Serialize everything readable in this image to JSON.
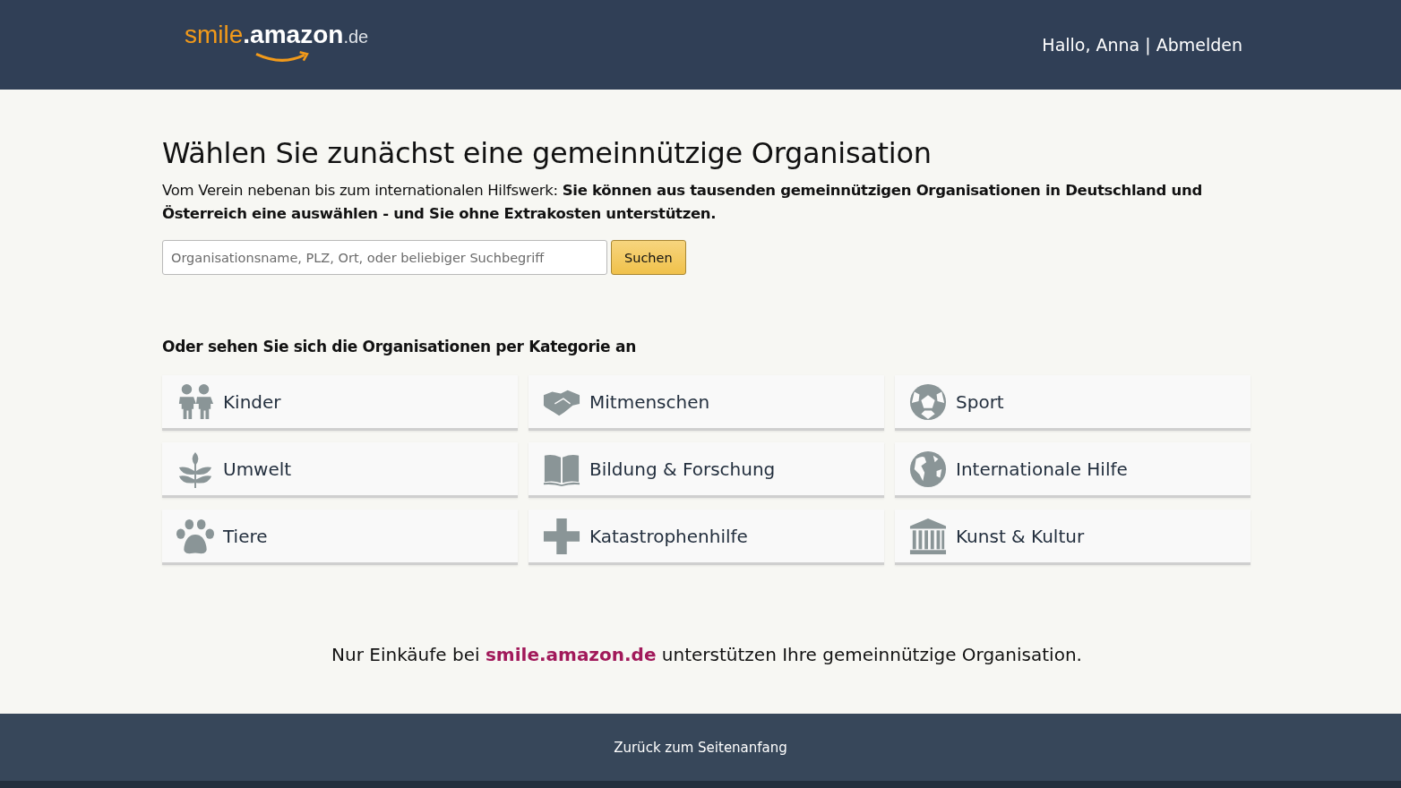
{
  "header": {
    "logo": {
      "smile": "smile",
      "brand": ".amazon",
      "tld": ".de"
    },
    "greeting": "Hallo, Anna",
    "separator": "|",
    "logout": "Abmelden"
  },
  "title": "Wählen Sie zunächst eine gemeinnützige Organisation",
  "intro": "Vom Verein nebenan bis zum internationalen Hilfswerk: **Sie können aus tausenden gemeinnützigen Organisationen in Deutschland und Österreich eine auswählen - und Sie ohne Extrakosten unterstützen.**",
  "search": {
    "placeholder": "Organisationsname, PLZ, Ort, oder beliebiger Suchbegriff",
    "button": "Suchen"
  },
  "categories_heading": "Oder sehen Sie sich die Organisationen per Kategorie an",
  "categories": [
    {
      "label": "Kinder",
      "kind": "children"
    },
    {
      "label": "Mitmenschen",
      "kind": "handshake"
    },
    {
      "label": "Sport",
      "kind": "ball"
    },
    {
      "label": "Umwelt",
      "kind": "plant"
    },
    {
      "label": "Bildung & Forschung",
      "kind": "book"
    },
    {
      "label": "Internationale Hilfe",
      "kind": "globe"
    },
    {
      "label": "Tiere",
      "kind": "paw"
    },
    {
      "label": "Katastrophenhilfe",
      "kind": "cross"
    },
    {
      "label": "Kunst & Kultur",
      "kind": "building"
    }
  ],
  "note": {
    "before": "Nur Einkäufe bei ",
    "link": "smile.amazon.de",
    "after": " unterstützen Ihre gemeinnützige Organisation."
  },
  "footer": {
    "back_to_top": "Zurück zum Seitenanfang"
  }
}
